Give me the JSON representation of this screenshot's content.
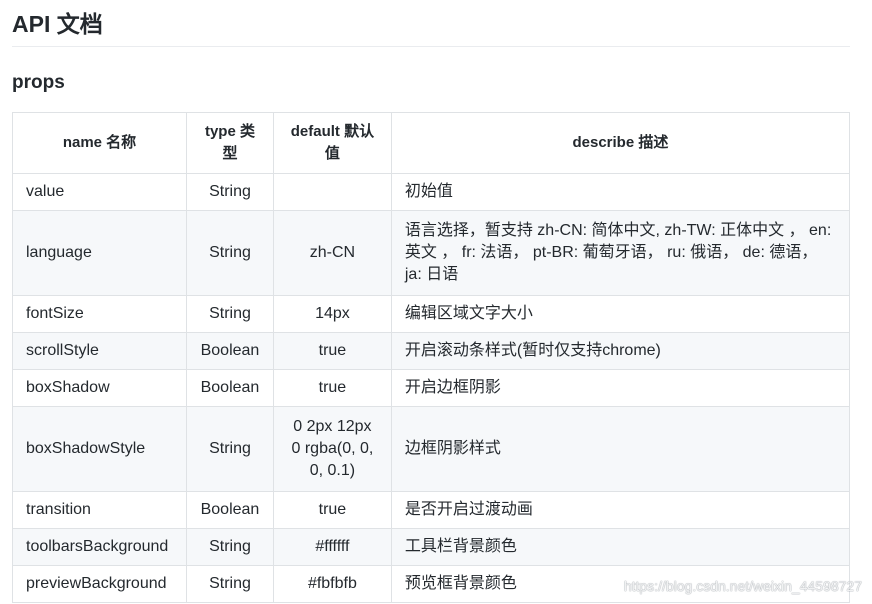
{
  "heading": "API 文档",
  "subheading": "props",
  "table": {
    "headers": {
      "name": "name 名称",
      "type": "type 类型",
      "default": "default 默认值",
      "describe": "describe 描述"
    },
    "rows": [
      {
        "name": "value",
        "type": "String",
        "default": "",
        "describe": "初始值"
      },
      {
        "name": "language",
        "type": "String",
        "default": "zh-CN",
        "describe": "语言选择，暂支持 zh-CN: 简体中文, zh-TW: 正体中文 ， en: 英文 ， fr: 法语， pt-BR: 葡萄牙语， ru: 俄语， de: 德语， ja: 日语"
      },
      {
        "name": "fontSize",
        "type": "String",
        "default": "14px",
        "describe": "编辑区域文字大小"
      },
      {
        "name": "scrollStyle",
        "type": "Boolean",
        "default": "true",
        "describe": "开启滚动条样式(暂时仅支持chrome)"
      },
      {
        "name": "boxShadow",
        "type": "Boolean",
        "default": "true",
        "describe": "开启边框阴影"
      },
      {
        "name": "boxShadowStyle",
        "type": "String",
        "default": "0 2px 12px 0 rgba(0, 0, 0, 0.1)",
        "describe": "边框阴影样式"
      },
      {
        "name": "transition",
        "type": "Boolean",
        "default": "true",
        "describe": "是否开启过渡动画"
      },
      {
        "name": "toolbarsBackground",
        "type": "String",
        "default": "#ffffff",
        "describe": "工具栏背景颜色"
      },
      {
        "name": "previewBackground",
        "type": "String",
        "default": "#fbfbfb",
        "describe": "预览框背景颜色"
      }
    ]
  },
  "watermark": "https://blog.csdn.net/weixin_44598727"
}
